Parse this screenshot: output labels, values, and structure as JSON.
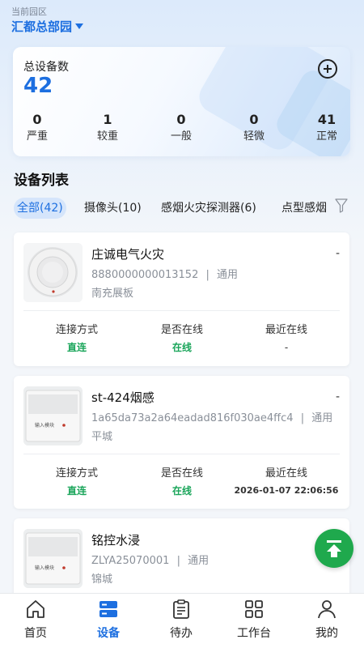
{
  "header": {
    "park_label": "当前园区",
    "park_name": "汇都总部园"
  },
  "summary": {
    "title": "总设备数",
    "total": "42",
    "stats": [
      {
        "value": "0",
        "label": "严重"
      },
      {
        "value": "1",
        "label": "较重"
      },
      {
        "value": "0",
        "label": "一般"
      },
      {
        "value": "0",
        "label": "轻微"
      },
      {
        "value": "41",
        "label": "正常"
      }
    ]
  },
  "device_list": {
    "title": "设备列表",
    "tabs": [
      {
        "label": "全部(42)",
        "active": true
      },
      {
        "label": "摄像头(10)",
        "active": false
      },
      {
        "label": "感烟火灾探测器(6)",
        "active": false
      },
      {
        "label": "点型感烟",
        "active": false
      }
    ]
  },
  "card_labels": {
    "connection": "连接方式",
    "online": "是否在线",
    "last_online": "最近在线"
  },
  "devices": [
    {
      "name": "庄诚电气火灾",
      "more": "-",
      "code": "8880000000013152",
      "type": "通用",
      "location": "南充展板",
      "connection": "直连",
      "online": "在线",
      "last_online": "-",
      "thumb": "smoke-detector"
    },
    {
      "name": "st-424烟感",
      "more": "-",
      "code": "1a65da73a2a64eadad816f030ae4ffc4",
      "type": "通用",
      "location": "平城",
      "connection": "直连",
      "online": "在线",
      "last_online": "2026-01-07 22:06:56",
      "thumb": "input-module",
      "thumb_text": "输入模块"
    },
    {
      "name": "铭控水浸",
      "code": "ZLYA25070001",
      "type": "通用",
      "location": "锦城",
      "thumb": "input-module",
      "thumb_text": "输入模块"
    }
  ],
  "meta_separator": "|",
  "bottom_nav": [
    {
      "label": "首页",
      "icon": "home-icon",
      "active": false
    },
    {
      "label": "设备",
      "icon": "device-icon",
      "active": true
    },
    {
      "label": "待办",
      "icon": "clipboard-icon",
      "active": false
    },
    {
      "label": "工作台",
      "icon": "grid-icon",
      "active": false
    },
    {
      "label": "我的",
      "icon": "user-icon",
      "active": false
    }
  ],
  "colors": {
    "accent": "#1d6fe0",
    "online_green": "#1aa55a",
    "fab_green": "#1fa94d"
  }
}
